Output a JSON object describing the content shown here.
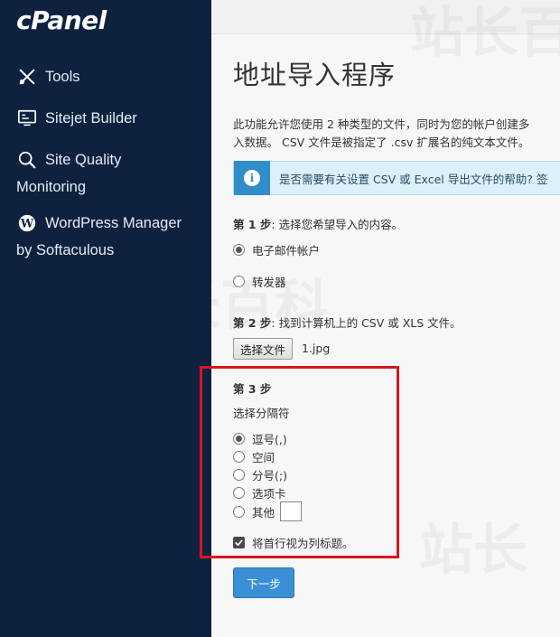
{
  "sidebar": {
    "logo": "cPanel",
    "items": [
      {
        "label": "Tools",
        "icon": "tools-icon"
      },
      {
        "label": "Sitejet Builder",
        "icon": "sitejet-icon"
      },
      {
        "label": "Site Quality",
        "label2": "Monitoring",
        "icon": "search-icon"
      },
      {
        "label": "WordPress Manager",
        "label2": "by Softaculous",
        "icon": "wordpress-icon"
      }
    ]
  },
  "main": {
    "title": "地址导入程序",
    "desc_line1": "此功能允许您使用 2 种类型的文件，同时为您的帐户创建多",
    "desc_line2": "入数据。 CSV 文件是被指定了 .csv 扩展名的纯文本文件。",
    "info_text": "是否需要有关设置 CSV 或 Excel 导出文件的帮助? 签",
    "step1": {
      "prefix": "第 1 步",
      "text": ": 选择您希望导入的内容。"
    },
    "step1_options": [
      "电子邮件帐户",
      "转发器"
    ],
    "step2": {
      "prefix": "第 2 步",
      "text": ": 找到计算机上的 CSV 或 XLS 文件。"
    },
    "choose_file_label": "选择文件",
    "file_name": "1.jpg",
    "step3": {
      "prefix": "第 3 步"
    },
    "separator_label": "选择分隔符",
    "separator_options": [
      "逗号(,)",
      "空间",
      "分号(;)",
      "选项卡",
      "其他"
    ],
    "header_checkbox_label": "将首行视为列标题。",
    "next_label": "下一步"
  },
  "colors": {
    "sidebar_bg": "#0e2240",
    "accent": "#3a8fd6",
    "highlight_border": "#d9161c"
  }
}
